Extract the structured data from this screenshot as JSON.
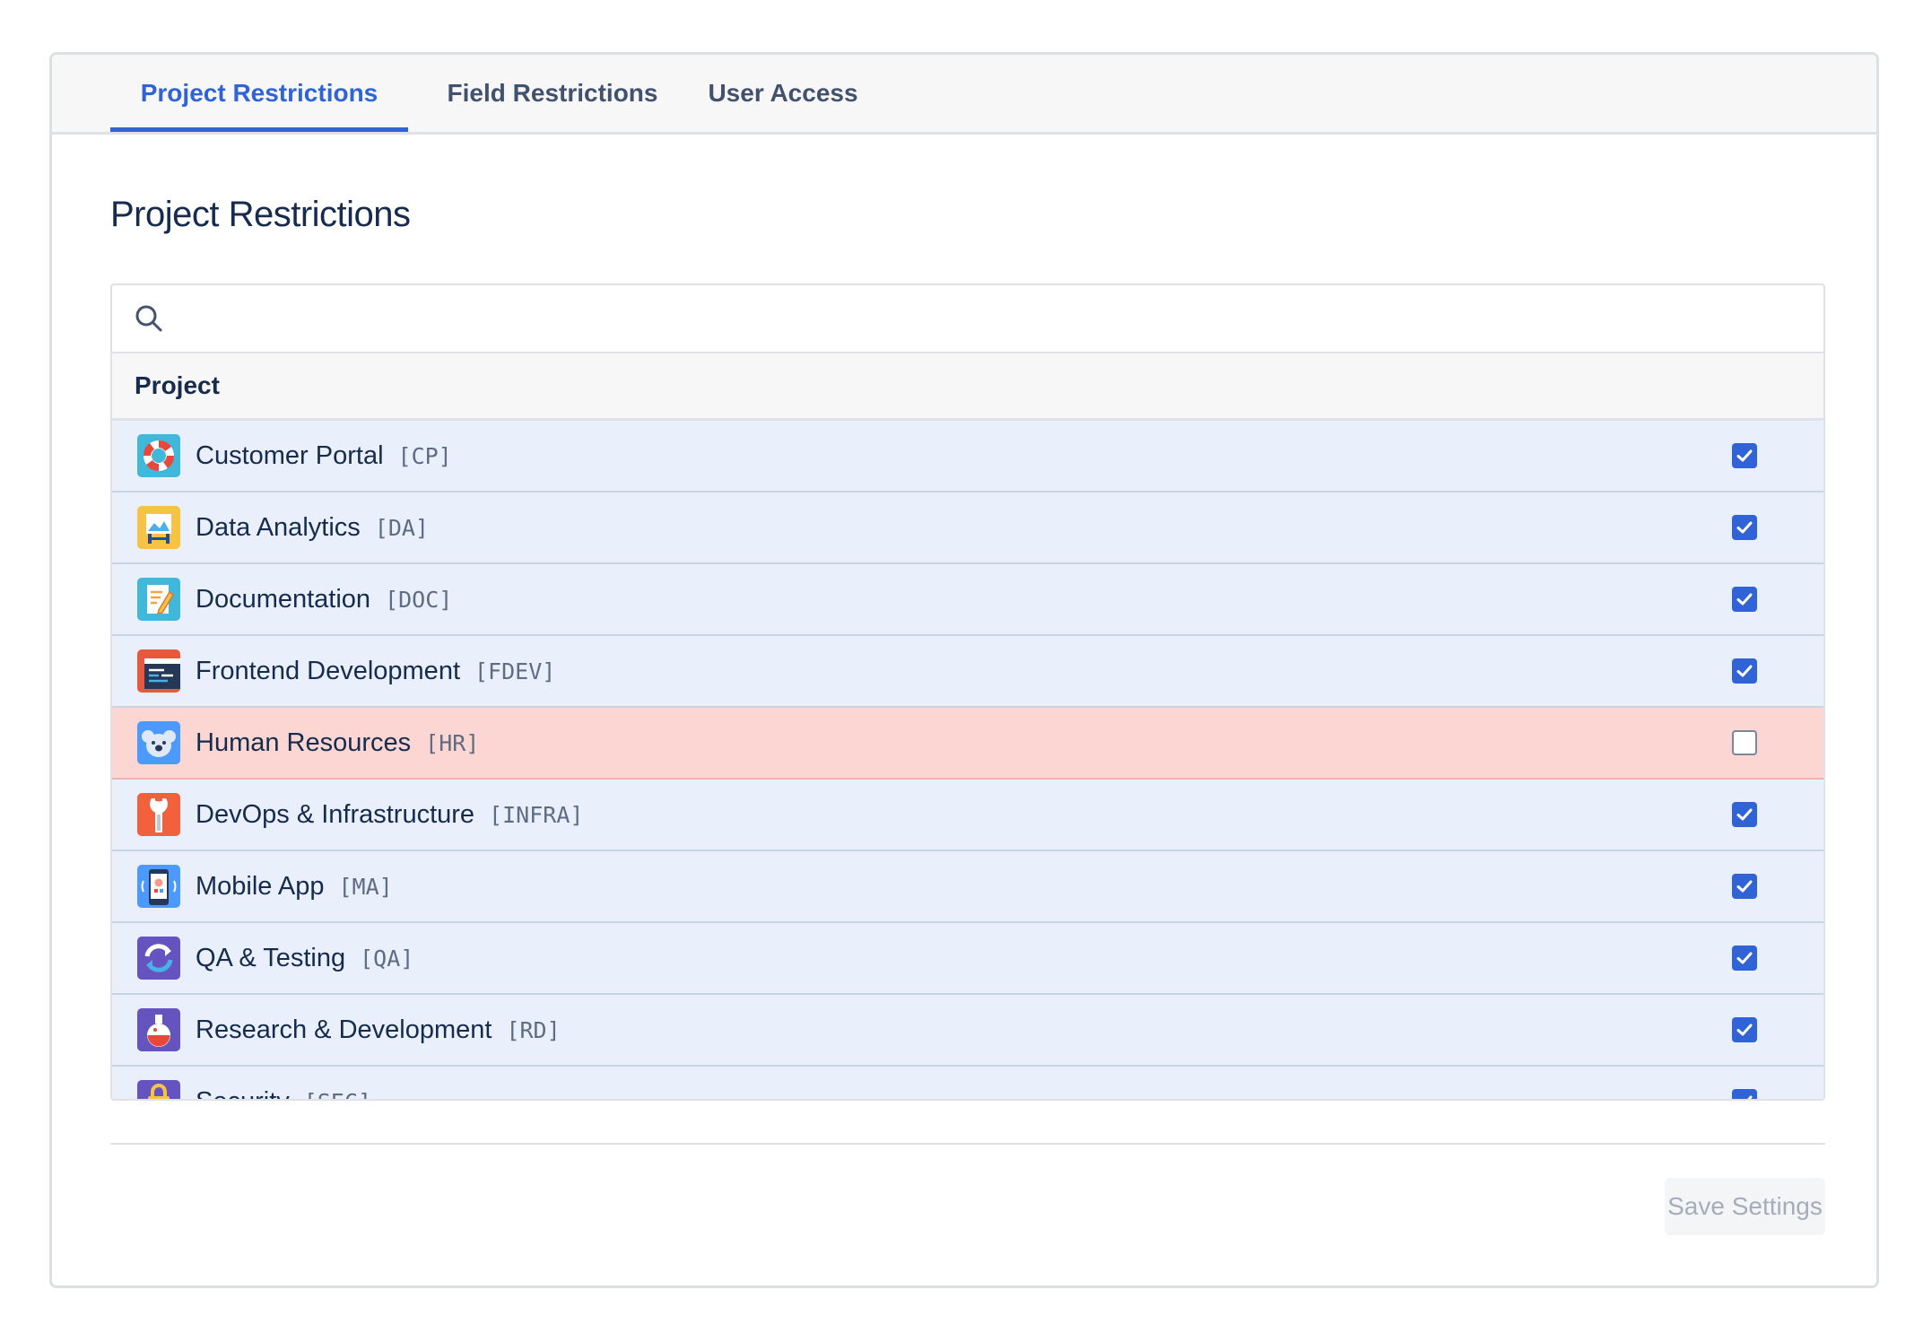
{
  "tabs": [
    {
      "label": "Project Restrictions",
      "active": true
    },
    {
      "label": "Field Restrictions",
      "active": false
    },
    {
      "label": "User Access",
      "active": false
    }
  ],
  "page_title": "Project Restrictions",
  "search": {
    "placeholder": "",
    "value": ""
  },
  "table": {
    "column_header": "Project",
    "rows": [
      {
        "name": "Customer Portal",
        "key": "[CP]",
        "icon": "lifebuoy-icon",
        "checked": true
      },
      {
        "name": "Data Analytics",
        "key": "[DA]",
        "icon": "easel-chart-icon",
        "checked": true
      },
      {
        "name": "Documentation",
        "key": "[DOC]",
        "icon": "notepad-pencil-icon",
        "checked": true
      },
      {
        "name": "Frontend Development",
        "key": "[FDEV]",
        "icon": "code-window-icon",
        "checked": true
      },
      {
        "name": "Human Resources",
        "key": "[HR]",
        "icon": "koala-icon",
        "checked": false
      },
      {
        "name": "DevOps & Infrastructure",
        "key": "[INFRA]",
        "icon": "wrench-icon",
        "checked": true
      },
      {
        "name": "Mobile App",
        "key": "[MA]",
        "icon": "phone-icon",
        "checked": true
      },
      {
        "name": "QA & Testing",
        "key": "[QA]",
        "icon": "refresh-icon",
        "checked": true
      },
      {
        "name": "Research & Development",
        "key": "[RD]",
        "icon": "flask-icon",
        "checked": true
      },
      {
        "name": "Security",
        "key": "[SEC]",
        "icon": "lock-icon",
        "checked": true
      }
    ]
  },
  "save_button": {
    "label": "Save Settings",
    "disabled": true
  },
  "colors": {
    "accent": "#2f63d6",
    "row_checked_bg": "#e9f0fb",
    "row_unchecked_bg": "#fcd6d3",
    "disabled_text": "#a5adba"
  }
}
